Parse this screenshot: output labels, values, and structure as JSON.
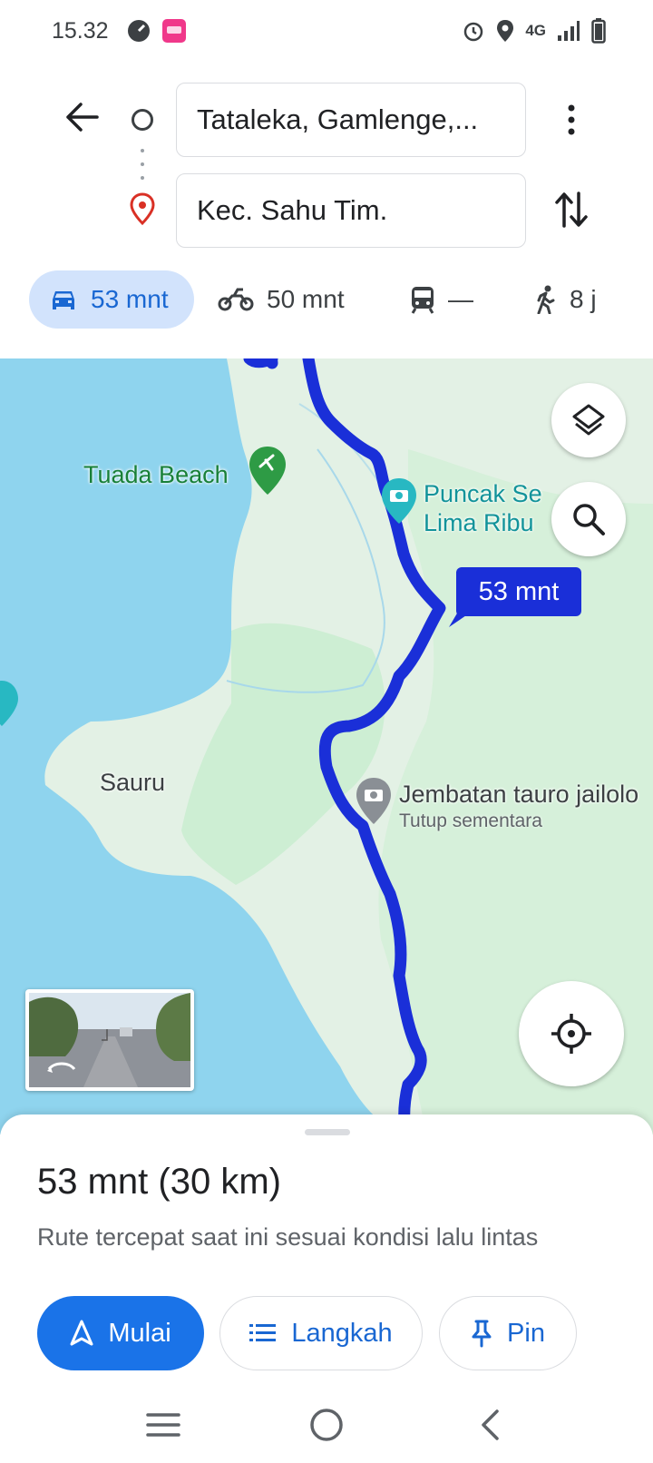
{
  "status_bar": {
    "time": "15.32",
    "network": "4G",
    "icons": [
      "speed-icon",
      "lazada-app-icon",
      "alarm-icon",
      "location-icon",
      "signal-icon",
      "battery-icon"
    ]
  },
  "directions": {
    "origin": "Tataleka, Gamlenge,...",
    "destination": "Kec. Sahu Tim."
  },
  "modes": [
    {
      "icon": "car-icon",
      "label": "53 mnt",
      "selected": true
    },
    {
      "icon": "motorcycle-icon",
      "label": "50 mnt",
      "selected": false
    },
    {
      "icon": "train-icon",
      "label": "—",
      "selected": false
    },
    {
      "icon": "walk-icon",
      "label": "8 j",
      "selected": false
    }
  ],
  "map": {
    "labels": {
      "beach": "Tuada Beach",
      "viewpoint_line1": "Puncak Se",
      "viewpoint_line2": "Lima Ribu",
      "village": "Sauru",
      "bridge": "Jembatan tauro jailolo",
      "bridge_status": "Tutup sementara"
    },
    "route_time": "53 mnt",
    "colors": {
      "route": "#1a2fd8",
      "water": "#8fd4ee",
      "land": "#e3f1e5",
      "park": "#cdeed3"
    }
  },
  "sheet": {
    "summary": "53 mnt (30 km)",
    "subtitle": "Rute tercepat saat ini sesuai kondisi lalu lintas",
    "buttons": {
      "start": "Mulai",
      "steps": "Langkah",
      "pin": "Pin"
    }
  },
  "colors": {
    "accent": "#1a73e8",
    "accent_text": "#1967d2",
    "selected_bg": "#d2e3fc"
  }
}
